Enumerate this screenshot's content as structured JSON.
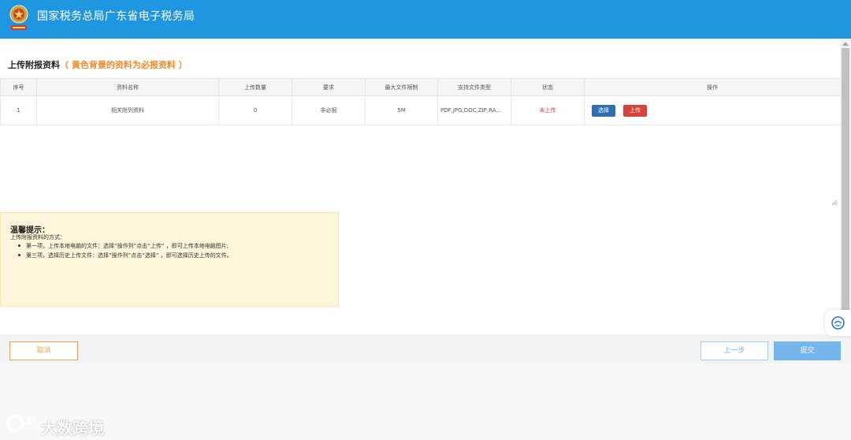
{
  "header": {
    "title": "国家税务总局广东省电子税务局",
    "emblem_icon": "tax-emblem-icon"
  },
  "section": {
    "title": "上传附报资料",
    "required_note": "（ 黄色背景的资料为必报资料 ）"
  },
  "table": {
    "columns": [
      "序号",
      "资料名称",
      "上传数量",
      "要求",
      "最大文件限制",
      "支持文件类型",
      "状态",
      "操作"
    ],
    "rows": [
      {
        "index": "1",
        "name": "相关附列资料",
        "count": "0",
        "requirement": "非必报",
        "max_size": "5M",
        "types": "PDF,JPG,DOC,ZIP,RA...",
        "status": "未上传",
        "select_label": "选择",
        "upload_label": "上传"
      }
    ]
  },
  "tips": {
    "title": "温馨提示：",
    "intro": "上传附报资料的方式：",
    "items": [
      "第一项，上传本地电脑的文件：选择“操作列”点击“上传” ，即可上传本地电脑图片;",
      "第三项，选择历史上传文件：选择“操作列”点击“选择” ，即可选择历史上传的文件。"
    ]
  },
  "footer": {
    "cancel_label": "取消",
    "prev_label": "上一步",
    "submit_label": "提交"
  },
  "watermark": {
    "text": "大数跨境"
  },
  "colors": {
    "header_bg": "#1f97e0",
    "required_note": "#f08a2a",
    "status_red": "#e03a2c",
    "select_button": "#2f6db5",
    "upload_button": "#d9423b",
    "tips_bg": "#fdf5d9",
    "submit_button": "#76b6ee",
    "cancel_border": "#f0a04b"
  }
}
